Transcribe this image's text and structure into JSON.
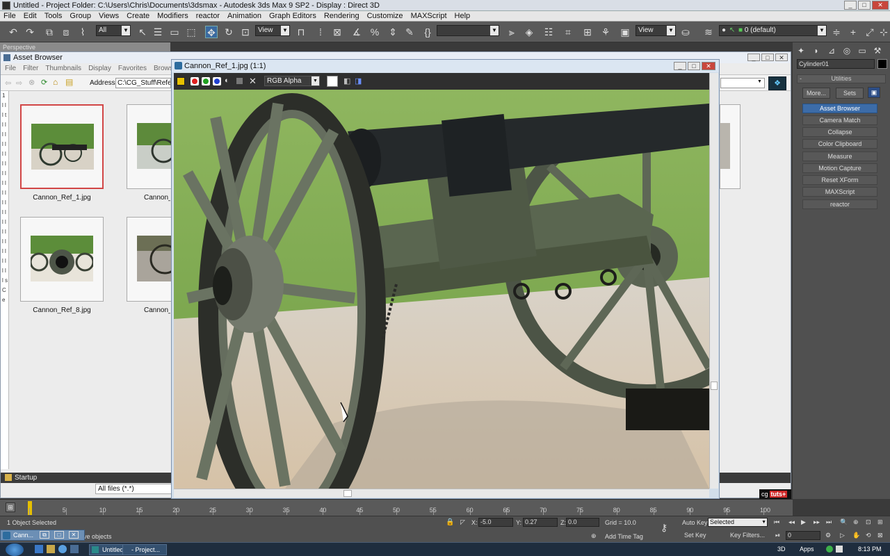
{
  "app": {
    "title": "Untitled    - Project Folder: C:\\Users\\Chris\\Documents\\3dsmax    - Autodesk 3ds Max 9 SP2    - Display : Direct 3D"
  },
  "menu": [
    "File",
    "Edit",
    "Tools",
    "Group",
    "Views",
    "Create",
    "Modifiers",
    "reactor",
    "Animation",
    "Graph Editors",
    "Rendering",
    "Customize",
    "MAXScript",
    "Help"
  ],
  "toolbar": {
    "selection_filter": "All",
    "ref_coord": "View",
    "ref_coord2": "View",
    "layer": "0 (default)"
  },
  "viewport_label": "Perspective",
  "asset_browser": {
    "title": "Asset Browser",
    "menu": [
      "File",
      "Filter",
      "Thumbnails",
      "Display",
      "Favorites",
      "Browse"
    ],
    "address_label": "Address:",
    "address_value": "C:\\CG_Stuff\\Refere",
    "thumbnails": [
      {
        "label": "Cannon_Ref_1.jpg"
      },
      {
        "label": "Cannon_F"
      },
      {
        "label": "Cannon_Ref_8.jpg"
      },
      {
        "label": "Cannon_V"
      }
    ],
    "left_letters": "1 l l l t l l l l l l l l l l l l l l l l l l l l l l l l l l l l l l l l l s C e",
    "folder": "Startup",
    "file_filter": "All files (*.*)"
  },
  "image_window": {
    "title": "Cannon_Ref_1.jpg (1:1)",
    "channel": "RGB Alpha"
  },
  "command_panel": {
    "object_name": "Cylinder01",
    "rollout": "Utilities",
    "more_label": "More...",
    "sets_label": "Sets",
    "utilities": [
      "Asset Browser",
      "Camera Match",
      "Collapse",
      "Color Clipboard",
      "Measure",
      "Motion Capture",
      "Reset XForm",
      "MAXScript",
      "reactor"
    ],
    "active_utility": "Asset Browser"
  },
  "timeline": {
    "ticks": [
      0,
      5,
      10,
      15,
      20,
      25,
      30,
      35,
      40,
      45,
      50,
      55,
      60,
      65,
      70,
      75,
      80,
      85,
      90,
      95,
      100
    ],
    "brand": "cg",
    "brand2": "tuts+"
  },
  "status": {
    "selection": "1 Object Selected",
    "prompt": "ve objects",
    "x_label": "X:",
    "x_value": "-5.0",
    "y_label": "Y:",
    "y_value": "0.27",
    "z_label": "Z:",
    "z_value": "0.0",
    "grid": "Grid = 10.0",
    "add_time_tag": "Add Time Tag",
    "auto_key": "Auto Key",
    "set_key": "Set Key",
    "key_mode": "Selected",
    "key_filters": "Key Filters...",
    "frame": "0"
  },
  "mini_window": {
    "label": "Cann..."
  },
  "taskbar": {
    "tasks": [
      "Untitled",
      "- Project..."
    ],
    "tray_3d": "3D",
    "apps": "Apps",
    "clock": "8:13 PM"
  }
}
